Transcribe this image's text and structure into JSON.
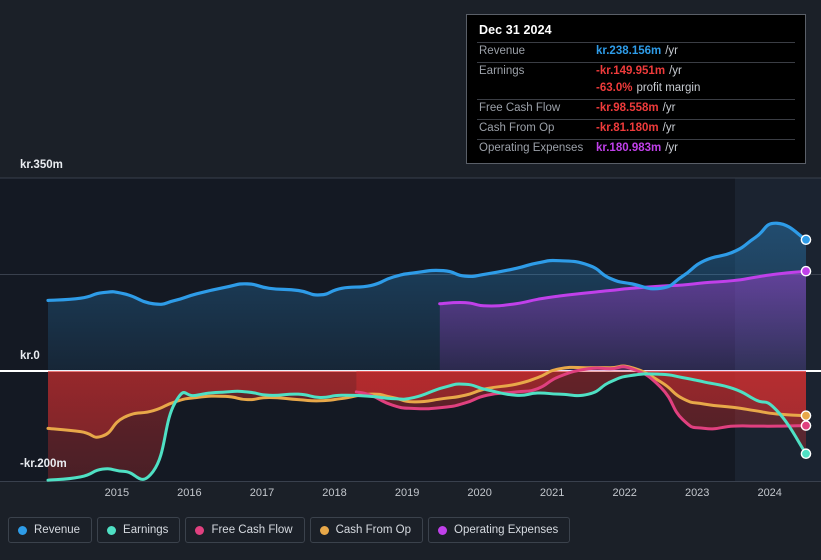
{
  "tooltip": {
    "date": "Dec 31 2024",
    "rows": [
      {
        "label": "Revenue",
        "value": "kr.238.156m",
        "unit": "/yr",
        "color": "rev"
      },
      {
        "label": "Earnings",
        "value": "-kr.149.951m",
        "unit": "/yr",
        "color": "neg"
      },
      {
        "label": "",
        "value": "-63.0%",
        "unit": "profit margin",
        "color": "neg"
      },
      {
        "label": "Free Cash Flow",
        "value": "-kr.98.558m",
        "unit": "/yr",
        "color": "neg"
      },
      {
        "label": "Cash From Op",
        "value": "-kr.81.180m",
        "unit": "/yr",
        "color": "neg"
      },
      {
        "label": "Operating Expenses",
        "value": "kr.180.983m",
        "unit": "/yr",
        "color": "opex"
      }
    ]
  },
  "legend": {
    "items": [
      {
        "label": "Revenue",
        "color": "#2e9ce8"
      },
      {
        "label": "Earnings",
        "color": "#4fe0c4"
      },
      {
        "label": "Free Cash Flow",
        "color": "#e0407f"
      },
      {
        "label": "Cash From Op",
        "color": "#e8a849"
      },
      {
        "label": "Operating Expenses",
        "color": "#c040ea"
      }
    ]
  },
  "axes": {
    "y_ticks": [
      {
        "label": "kr.350m",
        "value": 350
      },
      {
        "label": "kr.0",
        "value": 0
      },
      {
        "label": "-kr.200m",
        "value": -200
      }
    ],
    "x_ticks": [
      "2015",
      "2016",
      "2017",
      "2018",
      "2019",
      "2020",
      "2021",
      "2022",
      "2023",
      "2024"
    ]
  },
  "chart_data": {
    "type": "area",
    "title": "",
    "xlabel": "",
    "ylabel": "",
    "ylim": [
      -200,
      350
    ],
    "xlim": [
      2014.5,
      2025.0
    ],
    "grid": true,
    "legend_position": "bottom",
    "currency": "kr",
    "units": "millions per year",
    "gridlines": [
      350,
      175,
      0,
      -200
    ],
    "series": [
      {
        "name": "Revenue",
        "color": "#2e9ce8",
        "x": [
          2014.55,
          2015.0,
          2015.3,
          2015.6,
          2016.0,
          2016.3,
          2016.6,
          2017.0,
          2017.3,
          2017.6,
          2018.0,
          2018.3,
          2018.6,
          2019.0,
          2019.3,
          2019.6,
          2020.0,
          2020.3,
          2020.6,
          2021.0,
          2021.3,
          2021.6,
          2022.0,
          2022.3,
          2022.6,
          2023.0,
          2023.3,
          2023.6,
          2024.0,
          2024.3,
          2024.6,
          2025.0
        ],
        "values": [
          128,
          132,
          142,
          140,
          122,
          128,
          140,
          152,
          158,
          150,
          146,
          138,
          150,
          155,
          170,
          178,
          182,
          172,
          176,
          186,
          196,
          200,
          192,
          168,
          158,
          150,
          172,
          200,
          216,
          242,
          268,
          238
        ]
      },
      {
        "name": "Earnings",
        "color": "#4fe0c4",
        "x": [
          2014.55,
          2015.0,
          2015.3,
          2015.6,
          2016.0,
          2016.3,
          2016.6,
          2017.0,
          2017.3,
          2017.6,
          2018.0,
          2018.3,
          2018.6,
          2019.0,
          2019.3,
          2019.6,
          2020.0,
          2020.3,
          2020.6,
          2021.0,
          2021.3,
          2021.6,
          2022.0,
          2022.3,
          2022.6,
          2023.0,
          2023.3,
          2023.6,
          2024.0,
          2024.3,
          2024.6,
          2025.0
        ],
        "values": [
          -198,
          -192,
          -178,
          -182,
          -182,
          -58,
          -44,
          -38,
          -38,
          -44,
          -42,
          -48,
          -44,
          -46,
          -50,
          -48,
          -30,
          -24,
          -34,
          -44,
          -40,
          -42,
          -42,
          -20,
          -8,
          -6,
          -12,
          -20,
          -32,
          -52,
          -72,
          -150
        ]
      },
      {
        "name": "Free Cash Flow",
        "color": "#e0407f",
        "x": [
          2018.8,
          2019.0,
          2019.3,
          2019.6,
          2020.0,
          2020.3,
          2020.6,
          2021.0,
          2021.3,
          2021.6,
          2022.0,
          2022.3,
          2022.6,
          2023.0,
          2023.3,
          2023.6,
          2024.0,
          2024.3,
          2024.6,
          2025.0
        ],
        "values": [
          -38,
          -44,
          -62,
          -68,
          -66,
          -58,
          -44,
          -38,
          -32,
          -10,
          4,
          4,
          4,
          -30,
          -88,
          -104,
          -100,
          -100,
          -100,
          -99
        ]
      },
      {
        "name": "Cash From Op",
        "color": "#e8a849",
        "x": [
          2014.55,
          2015.0,
          2015.3,
          2015.6,
          2016.0,
          2016.3,
          2016.6,
          2017.0,
          2017.3,
          2017.6,
          2018.0,
          2018.3,
          2018.6,
          2019.0,
          2019.3,
          2019.6,
          2020.0,
          2020.3,
          2020.6,
          2021.0,
          2021.3,
          2021.6,
          2022.0,
          2022.3,
          2022.6,
          2023.0,
          2023.3,
          2023.6,
          2024.0,
          2024.3,
          2024.6,
          2025.0
        ],
        "values": [
          -104,
          -110,
          -118,
          -84,
          -72,
          -56,
          -48,
          -46,
          -52,
          -48,
          -52,
          -54,
          -50,
          -42,
          -48,
          -56,
          -50,
          -44,
          -32,
          -24,
          -12,
          4,
          6,
          6,
          6,
          -20,
          -50,
          -60,
          -66,
          -72,
          -78,
          -81
        ]
      },
      {
        "name": "Operating Expenses",
        "color": "#c040ea",
        "x": [
          2019.95,
          2020.3,
          2020.6,
          2021.0,
          2021.3,
          2021.6,
          2022.0,
          2022.3,
          2022.6,
          2023.0,
          2023.3,
          2023.6,
          2024.0,
          2024.3,
          2024.6,
          2025.0
        ],
        "values": [
          122,
          124,
          118,
          122,
          130,
          136,
          142,
          146,
          150,
          154,
          156,
          160,
          164,
          170,
          176,
          181
        ]
      }
    ]
  }
}
